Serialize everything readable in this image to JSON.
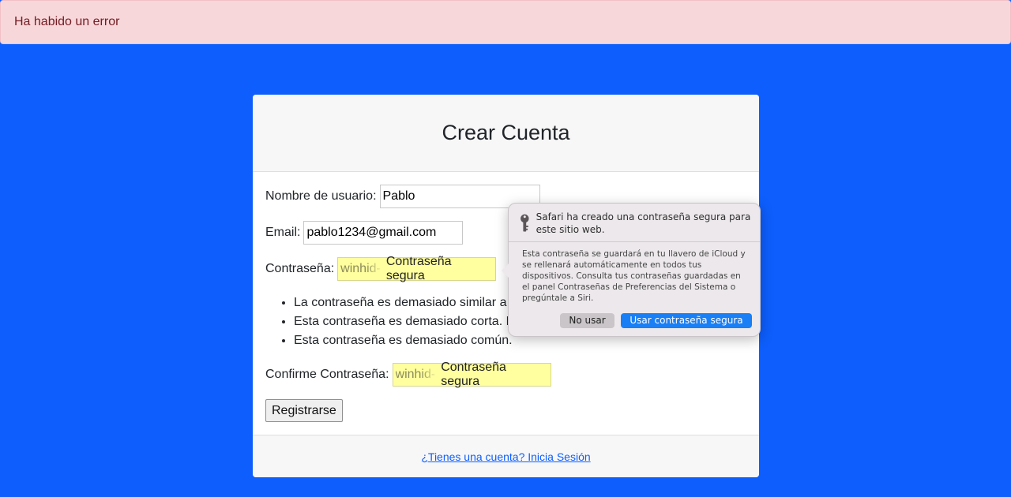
{
  "alert": {
    "text": "Ha habido un error"
  },
  "card": {
    "title": "Crear Cuenta",
    "fields": {
      "username_label": "Nombre de usuario:",
      "username_value": "Pablo",
      "email_label": "Email:",
      "email_value": "pablo1234@gmail.com",
      "password_label": "Contraseña:",
      "password_ghost": "winhid-",
      "password_strong": "Contraseña segura",
      "confirm_label": "Confirme Contraseña:",
      "confirm_ghost": "winhid-",
      "confirm_strong": "Contraseña segura"
    },
    "errors": [
      "La contraseña es demasiado similar a",
      "Esta contraseña es demasiado corta. D",
      "Esta contraseña es demasiado común."
    ],
    "submit_label": "Registrarse",
    "footer_link": "¿Tienes una cuenta? Inicia Sesión"
  },
  "popover": {
    "title": "Safari ha creado una contraseña segura para este sitio web.",
    "body": "Esta contraseña se guardará en tu llavero de iCloud y se rellenará automáticamente en todos tus dispositivos. Consulta tus contraseñas guardadas en el panel Contraseñas de Preferencias del Sistema o pregúntale a Siri.",
    "no_label": "No usar",
    "yes_label": "Usar contraseña segura",
    "icon": "key-icon"
  },
  "colors": {
    "background": "#0d5efc",
    "alert_bg": "#f8d7da",
    "alert_text": "#721c24",
    "autofill": "#ffff9f",
    "link": "#0d5efc",
    "accent_button": "#1a7ff5"
  }
}
